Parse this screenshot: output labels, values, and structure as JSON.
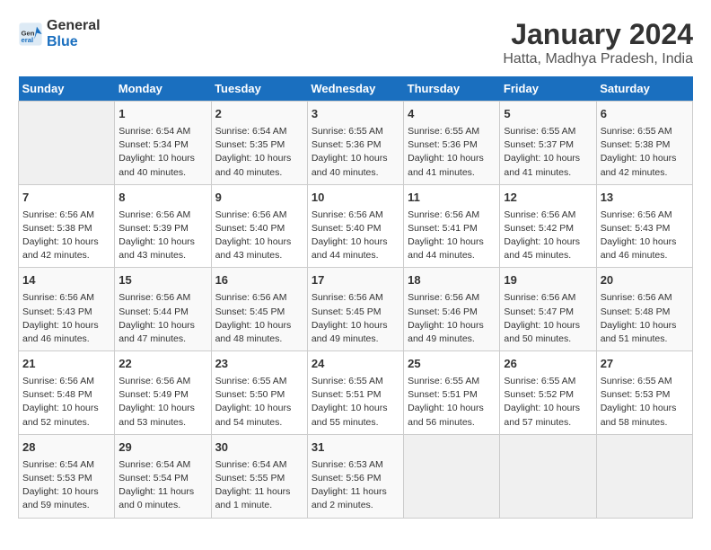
{
  "logo": {
    "line1": "General",
    "line2": "Blue"
  },
  "title": "January 2024",
  "subtitle": "Hatta, Madhya Pradesh, India",
  "days_of_week": [
    "Sunday",
    "Monday",
    "Tuesday",
    "Wednesday",
    "Thursday",
    "Friday",
    "Saturday"
  ],
  "weeks": [
    [
      {
        "day": "",
        "content": ""
      },
      {
        "day": "1",
        "content": "Sunrise: 6:54 AM\nSunset: 5:34 PM\nDaylight: 10 hours\nand 40 minutes."
      },
      {
        "day": "2",
        "content": "Sunrise: 6:54 AM\nSunset: 5:35 PM\nDaylight: 10 hours\nand 40 minutes."
      },
      {
        "day": "3",
        "content": "Sunrise: 6:55 AM\nSunset: 5:36 PM\nDaylight: 10 hours\nand 40 minutes."
      },
      {
        "day": "4",
        "content": "Sunrise: 6:55 AM\nSunset: 5:36 PM\nDaylight: 10 hours\nand 41 minutes."
      },
      {
        "day": "5",
        "content": "Sunrise: 6:55 AM\nSunset: 5:37 PM\nDaylight: 10 hours\nand 41 minutes."
      },
      {
        "day": "6",
        "content": "Sunrise: 6:55 AM\nSunset: 5:38 PM\nDaylight: 10 hours\nand 42 minutes."
      }
    ],
    [
      {
        "day": "7",
        "content": "Sunrise: 6:56 AM\nSunset: 5:38 PM\nDaylight: 10 hours\nand 42 minutes."
      },
      {
        "day": "8",
        "content": "Sunrise: 6:56 AM\nSunset: 5:39 PM\nDaylight: 10 hours\nand 43 minutes."
      },
      {
        "day": "9",
        "content": "Sunrise: 6:56 AM\nSunset: 5:40 PM\nDaylight: 10 hours\nand 43 minutes."
      },
      {
        "day": "10",
        "content": "Sunrise: 6:56 AM\nSunset: 5:40 PM\nDaylight: 10 hours\nand 44 minutes."
      },
      {
        "day": "11",
        "content": "Sunrise: 6:56 AM\nSunset: 5:41 PM\nDaylight: 10 hours\nand 44 minutes."
      },
      {
        "day": "12",
        "content": "Sunrise: 6:56 AM\nSunset: 5:42 PM\nDaylight: 10 hours\nand 45 minutes."
      },
      {
        "day": "13",
        "content": "Sunrise: 6:56 AM\nSunset: 5:43 PM\nDaylight: 10 hours\nand 46 minutes."
      }
    ],
    [
      {
        "day": "14",
        "content": "Sunrise: 6:56 AM\nSunset: 5:43 PM\nDaylight: 10 hours\nand 46 minutes."
      },
      {
        "day": "15",
        "content": "Sunrise: 6:56 AM\nSunset: 5:44 PM\nDaylight: 10 hours\nand 47 minutes."
      },
      {
        "day": "16",
        "content": "Sunrise: 6:56 AM\nSunset: 5:45 PM\nDaylight: 10 hours\nand 48 minutes."
      },
      {
        "day": "17",
        "content": "Sunrise: 6:56 AM\nSunset: 5:45 PM\nDaylight: 10 hours\nand 49 minutes."
      },
      {
        "day": "18",
        "content": "Sunrise: 6:56 AM\nSunset: 5:46 PM\nDaylight: 10 hours\nand 49 minutes."
      },
      {
        "day": "19",
        "content": "Sunrise: 6:56 AM\nSunset: 5:47 PM\nDaylight: 10 hours\nand 50 minutes."
      },
      {
        "day": "20",
        "content": "Sunrise: 6:56 AM\nSunset: 5:48 PM\nDaylight: 10 hours\nand 51 minutes."
      }
    ],
    [
      {
        "day": "21",
        "content": "Sunrise: 6:56 AM\nSunset: 5:48 PM\nDaylight: 10 hours\nand 52 minutes."
      },
      {
        "day": "22",
        "content": "Sunrise: 6:56 AM\nSunset: 5:49 PM\nDaylight: 10 hours\nand 53 minutes."
      },
      {
        "day": "23",
        "content": "Sunrise: 6:55 AM\nSunset: 5:50 PM\nDaylight: 10 hours\nand 54 minutes."
      },
      {
        "day": "24",
        "content": "Sunrise: 6:55 AM\nSunset: 5:51 PM\nDaylight: 10 hours\nand 55 minutes."
      },
      {
        "day": "25",
        "content": "Sunrise: 6:55 AM\nSunset: 5:51 PM\nDaylight: 10 hours\nand 56 minutes."
      },
      {
        "day": "26",
        "content": "Sunrise: 6:55 AM\nSunset: 5:52 PM\nDaylight: 10 hours\nand 57 minutes."
      },
      {
        "day": "27",
        "content": "Sunrise: 6:55 AM\nSunset: 5:53 PM\nDaylight: 10 hours\nand 58 minutes."
      }
    ],
    [
      {
        "day": "28",
        "content": "Sunrise: 6:54 AM\nSunset: 5:53 PM\nDaylight: 10 hours\nand 59 minutes."
      },
      {
        "day": "29",
        "content": "Sunrise: 6:54 AM\nSunset: 5:54 PM\nDaylight: 11 hours\nand 0 minutes."
      },
      {
        "day": "30",
        "content": "Sunrise: 6:54 AM\nSunset: 5:55 PM\nDaylight: 11 hours\nand 1 minute."
      },
      {
        "day": "31",
        "content": "Sunrise: 6:53 AM\nSunset: 5:56 PM\nDaylight: 11 hours\nand 2 minutes."
      },
      {
        "day": "",
        "content": ""
      },
      {
        "day": "",
        "content": ""
      },
      {
        "day": "",
        "content": ""
      }
    ]
  ]
}
